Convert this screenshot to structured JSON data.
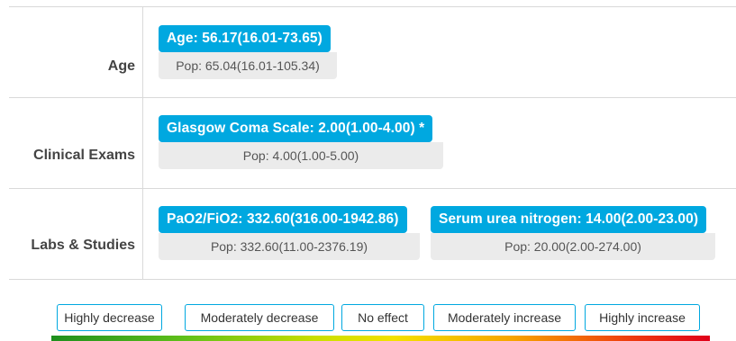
{
  "rows": [
    {
      "label": "Age",
      "cards": [
        {
          "title": "Age: 56.17(16.01-73.65)",
          "pop": "Pop: 65.04(16.01-105.34)"
        }
      ]
    },
    {
      "label": "Clinical Exams",
      "cards": [
        {
          "title": "Glasgow Coma Scale: 2.00(1.00-4.00) *",
          "pop": "Pop: 4.00(1.00-5.00)"
        }
      ]
    },
    {
      "label": "Labs & Studies",
      "cards": [
        {
          "title": "PaO2/FiO2: 332.60(316.00-1942.86)",
          "pop": "Pop: 332.60(11.00-2376.19)"
        },
        {
          "title": "Serum urea nitrogen: 14.00(2.00-23.00)",
          "pop": "Pop: 20.00(2.00-274.00)"
        }
      ]
    }
  ],
  "legend": {
    "items": [
      "Highly decrease",
      "Moderately decrease",
      "No effect",
      "Moderately increase",
      "Highly increase"
    ],
    "gradient_colors": [
      "#1e8f1e",
      "#c9df00",
      "#f3e100",
      "#f7a400",
      "#e0001a"
    ]
  },
  "colors": {
    "accent": "#00a8e0",
    "pop_bg": "#ebebeb"
  }
}
